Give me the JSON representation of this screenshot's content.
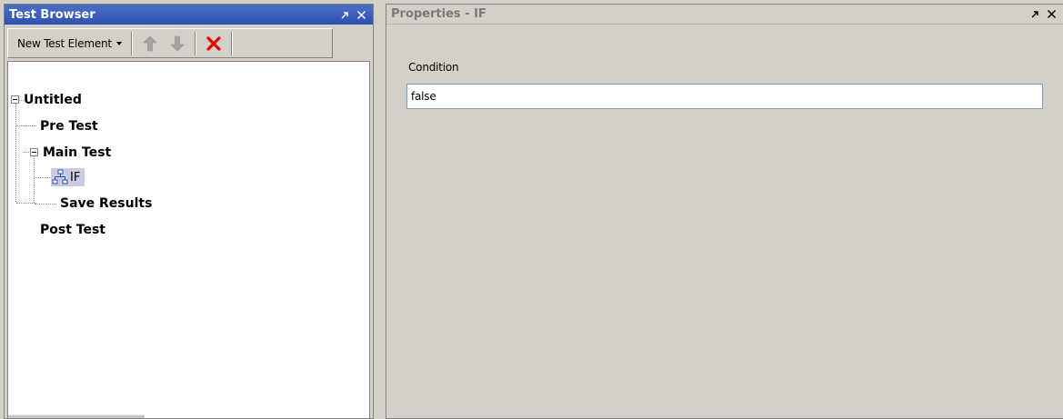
{
  "test_browser": {
    "title": "Test Browser",
    "toolbar": {
      "new_element_label": "New Test Element"
    },
    "tree": {
      "root": "Untitled",
      "pre_test": "Pre Test",
      "main_test": "Main Test",
      "if_node": "IF",
      "save_results": "Save Results",
      "post_test": "Post Test"
    },
    "icons": {
      "pin": "pin-icon",
      "close": "close-icon",
      "move_up": "arrow-up-icon",
      "move_down": "arrow-down-icon",
      "delete": "delete-x-icon",
      "if_node": "flowchart-icon"
    }
  },
  "properties": {
    "title": "Properties - IF",
    "condition_label": "Condition",
    "condition_value": "false"
  },
  "colors": {
    "active_title": "#3a5fbf",
    "selection": "#c9cbe3",
    "delete_red": "#e00000",
    "arrow_gray": "#9a9a9a"
  }
}
